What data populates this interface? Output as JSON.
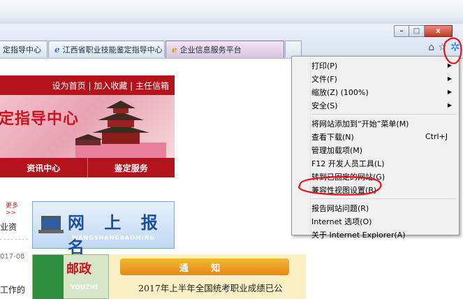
{
  "window": {
    "minimize_label": "–",
    "maximize_label": "□",
    "close_label": "x"
  },
  "tabs": [
    {
      "label": "定指导中心",
      "icon": "ie-page-icon"
    },
    {
      "label": "江西省职业技能鉴定指导中心",
      "icon": "ie-page-icon"
    },
    {
      "label": "企业信息服务平台",
      "icon": "ie-page-icon"
    }
  ],
  "toolbar": {
    "home_icon": "home-icon",
    "favorites_icon": "star-icon",
    "tools_icon": "gear-icon"
  },
  "site": {
    "top_links": "设为首页 | 加入收藏 | 主任信箱",
    "banner_title": "定指导中心",
    "nav": [
      "资讯中心",
      "鉴定服务"
    ],
    "more": "更多>>",
    "left_snippets": [
      "业资",
      "017-08",
      "工作的"
    ],
    "register_title": "网 上 报 名",
    "register_subtitle": "WANGSHANGBAOMING",
    "post_title": "邮政",
    "post_subtitle": "YOUZHI",
    "notice_head": "通 知",
    "notice_text": "2017年上半年全国统考职业成绩已公"
  },
  "menu": {
    "items": [
      {
        "label": "打印(P)",
        "shortcut": "",
        "submenu": true
      },
      {
        "label": "文件(F)",
        "shortcut": "",
        "submenu": true
      },
      {
        "label": "缩放(Z) (100%)",
        "shortcut": "",
        "submenu": true
      },
      {
        "label": "安全(S)",
        "shortcut": "",
        "submenu": true
      },
      {
        "label": "将网站添加到“开始”菜单(M)",
        "shortcut": "",
        "submenu": false
      },
      {
        "label": "查看下载(N)",
        "shortcut": "Ctrl+J",
        "submenu": false
      },
      {
        "label": "管理加载项(M)",
        "shortcut": "",
        "submenu": false
      },
      {
        "label": "F12 开发人员工具(L)",
        "shortcut": "",
        "submenu": false
      },
      {
        "label": "转到已固定的网站(G)",
        "shortcut": "",
        "submenu": false
      },
      {
        "label": "兼容性视图设置(B)",
        "shortcut": "",
        "submenu": false
      },
      {
        "label": "报告网站问题(R)",
        "shortcut": "",
        "submenu": false
      },
      {
        "label": "Internet 选项(O)",
        "shortcut": "",
        "submenu": false
      },
      {
        "label": "关于 Internet Explorer(A)",
        "shortcut": "",
        "submenu": false
      }
    ],
    "arrow_glyph": "▶"
  },
  "colors": {
    "site_red": "#b3131b",
    "annotation_red": "#e8101a",
    "menu_bg": "#f0f0f0"
  }
}
